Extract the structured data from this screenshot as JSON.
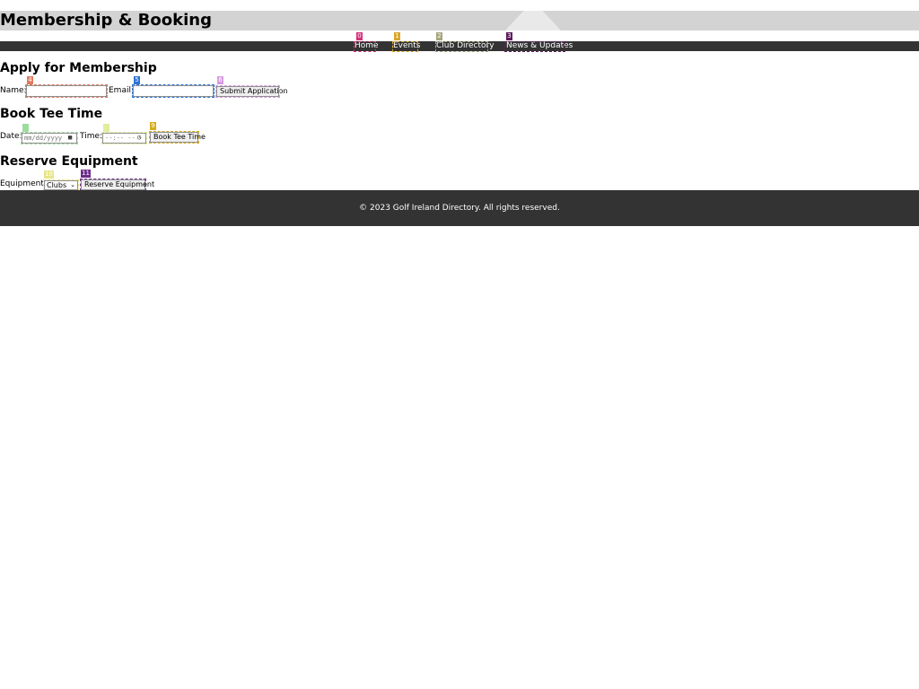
{
  "header": {
    "title": "Membership & Booking"
  },
  "nav": {
    "items": [
      {
        "label": "Home",
        "marker": "0"
      },
      {
        "label": "Events",
        "marker": "1"
      },
      {
        "label": "Club Directory",
        "marker": "2"
      },
      {
        "label": "News & Updates",
        "marker": "3"
      }
    ]
  },
  "membership": {
    "heading": "Apply for Membership",
    "name_label": "Name:",
    "name_value": "",
    "name_marker": "4",
    "email_label": "Email:",
    "email_value": "",
    "email_marker": "5",
    "submit_label": "Submit Application",
    "submit_marker": "6"
  },
  "tee_time": {
    "heading": "Book Tee Time",
    "date_label": "Date:",
    "date_placeholder": "mm/dd/yyyy",
    "date_marker": "7",
    "time_label": "Time:",
    "time_placeholder": "--:-- --",
    "time_marker": "8",
    "book_label": "Book Tee Time",
    "book_marker": "9"
  },
  "equipment": {
    "heading": "Reserve Equipment",
    "equipment_label": "Equipment:",
    "selected_option": "Clubs",
    "select_marker": "10",
    "reserve_label": "Reserve Equipment",
    "reserve_marker": "11"
  },
  "footer": {
    "copyright": "© 2023 Golf Ireland Directory. All rights reserved."
  },
  "icons": {
    "calendar": "calendar-icon",
    "clock": "clock-icon",
    "dropdown": "chevron-down-icon"
  },
  "colors": {
    "title_bar": "#d3d3d3",
    "nav_bar": "#333333",
    "footer_bar": "#333333",
    "marker_0": "#d6307a",
    "marker_1": "#d8a62a",
    "marker_2": "#a7a57c",
    "marker_3": "#5e1e5c",
    "marker_4": "#e07a5f",
    "marker_5": "#2a73d6",
    "marker_6": "#d69ae0",
    "marker_7": "#9edc9e",
    "marker_8": "#e2ec9e",
    "marker_9": "#d4ac1e",
    "marker_10": "#e6e68a",
    "marker_11": "#6e2c8a"
  }
}
